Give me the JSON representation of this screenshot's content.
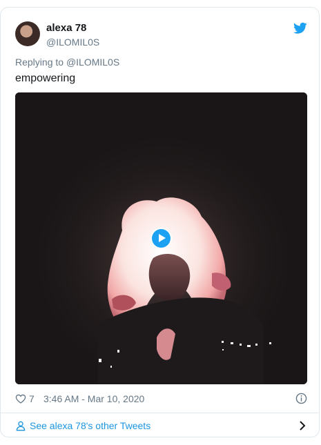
{
  "tweet": {
    "author_name": "alexa 78",
    "author_handle": "@ILOMIL0S",
    "replying_prefix": "Replying to",
    "replying_to": "@ILOMIL0S",
    "text": "empowering",
    "media_type": "video",
    "like_count": "7",
    "timestamp": "3:46 AM - Mar 10, 2020",
    "more_tweets_label": "See alexa 78's other Tweets"
  },
  "icons": {
    "brand": "twitter-bird-icon",
    "like": "heart-icon",
    "info": "info-icon",
    "profile": "person-icon",
    "next": "chevron-right-icon",
    "video": "play-icon"
  },
  "colors": {
    "brand_blue": "#1da1f2",
    "link_blue": "#1b95e0",
    "secondary_text": "#657786",
    "border": "#e1e8ed"
  }
}
